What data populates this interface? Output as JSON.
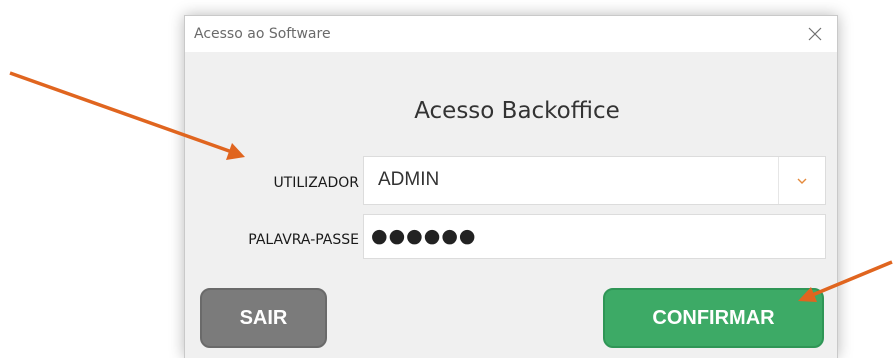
{
  "window": {
    "title": "Acesso ao Software"
  },
  "form": {
    "heading": "Acesso Backoffice",
    "user_label": "UTILIZADOR",
    "user_value": "ADMIN",
    "password_label": "PALAVRA-PASSE",
    "password_mask": "●●●●●●"
  },
  "buttons": {
    "exit_label": "SAIR",
    "confirm_label": "CONFIRMAR"
  },
  "colors": {
    "confirm": "#3daa66",
    "exit": "#7b7b7b",
    "annotation_arrow": "#e0651f",
    "dropdown_chevron": "#e58a3c"
  },
  "icons": {
    "close": "close-icon",
    "dropdown": "chevron-down-icon"
  }
}
